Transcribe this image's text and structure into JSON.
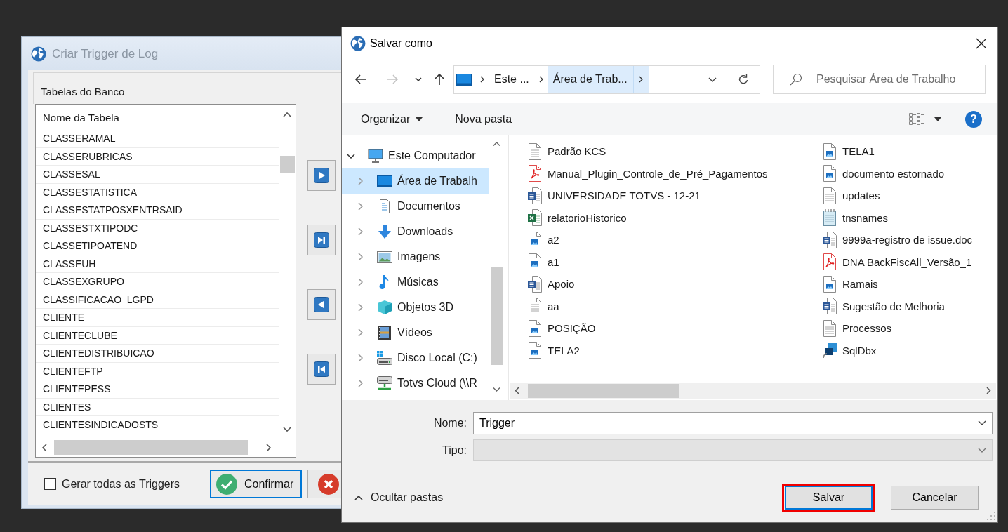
{
  "log_dialog": {
    "title": "Criar Trigger de Log",
    "active": false,
    "group_title": "Tabelas do Banco",
    "table_list": {
      "column": "Nome da Tabela",
      "rows": [
        {
          "name": "CLASSERAMAL",
          "selected": false
        },
        {
          "name": "CLASSERUBRICAS",
          "selected": false
        },
        {
          "name": "CLASSESAL",
          "selected": false
        },
        {
          "name": "CLASSESTATISTICA",
          "selected": false
        },
        {
          "name": "CLASSESTATPOSXENTRSAID",
          "selected": false
        },
        {
          "name": "CLASSESTXTIPODC",
          "selected": false
        },
        {
          "name": "CLASSETIPOATEND",
          "selected": false
        },
        {
          "name": "CLASSEUH",
          "selected": false
        },
        {
          "name": "CLASSEXGRUPO",
          "selected": false
        },
        {
          "name": "CLASSIFICACAO_LGPD",
          "selected": false
        },
        {
          "name": "CLIENTE",
          "selected": false
        },
        {
          "name": "CLIENTECLUBE",
          "selected": false
        },
        {
          "name": "CLIENTEDISTRIBUICAO",
          "selected": false
        },
        {
          "name": "CLIENTEFTP",
          "selected": false
        },
        {
          "name": "CLIENTEPESS",
          "selected": false
        },
        {
          "name": "CLIENTES",
          "selected": false
        },
        {
          "name": "CLIENTESINDICADOSTS",
          "selected": false
        }
      ]
    },
    "generate_all": {
      "label": "Gerar todas as Triggers",
      "checked": false
    },
    "confirm_button": {
      "label": "Confirmar",
      "focused": true
    }
  },
  "save_dialog": {
    "title": "Salvar como",
    "active": true,
    "nav_buttons": [
      {
        "kind": "back",
        "disabled": false
      },
      {
        "kind": "forward",
        "disabled": true
      },
      {
        "kind": "recent",
        "disabled": false
      },
      {
        "kind": "up",
        "disabled": false
      }
    ],
    "address_bar": {
      "segments": [
        {
          "label": "Este ...",
          "selected": false
        },
        {
          "label": "Área de Trab...",
          "selected": true
        }
      ]
    },
    "search": {
      "placeholder": "Pesquisar Área de Trabalho"
    },
    "toolbar": {
      "organize": "Organizar",
      "new_folder": "Nova pasta",
      "help": "?"
    },
    "nav_tree": [
      {
        "label": "Este Computador",
        "kind": "computer",
        "expanded": true,
        "selected": false,
        "children": [
          {
            "label": "Área de Trabalh",
            "kind": "desktop",
            "expanded": false,
            "selected": true
          },
          {
            "label": "Documentos",
            "kind": "documents",
            "expanded": false,
            "selected": false
          },
          {
            "label": "Downloads",
            "kind": "downloads",
            "expanded": false,
            "selected": false
          },
          {
            "label": "Imagens",
            "kind": "pictures",
            "expanded": false,
            "selected": false
          },
          {
            "label": "Músicas",
            "kind": "music",
            "expanded": false,
            "selected": false
          },
          {
            "label": "Objetos 3D",
            "kind": "objects3d",
            "expanded": false,
            "selected": false
          },
          {
            "label": "Vídeos",
            "kind": "videos",
            "expanded": false,
            "selected": false
          },
          {
            "label": "Disco Local (C:)",
            "kind": "drive",
            "expanded": false,
            "selected": false
          },
          {
            "label": "Totvs Cloud (\\\\R",
            "kind": "netdrive",
            "expanded": false,
            "selected": false
          }
        ]
      }
    ],
    "files": [
      {
        "name": "Padrão KCS",
        "kind": "text",
        "selected": false
      },
      {
        "name": "Manual_Plugin_Controle_de_Pré_Pagamentos",
        "kind": "pdf",
        "selected": false
      },
      {
        "name": "UNIVERSIDADE TOTVS - 12-21",
        "kind": "word",
        "selected": false
      },
      {
        "name": "relatorioHistorico",
        "kind": "excel",
        "selected": false
      },
      {
        "name": "a2",
        "kind": "image",
        "selected": false
      },
      {
        "name": "a1",
        "kind": "image",
        "selected": false
      },
      {
        "name": "Apoio",
        "kind": "word",
        "selected": false
      },
      {
        "name": "aa",
        "kind": "text",
        "selected": false
      },
      {
        "name": "POSIÇÃO",
        "kind": "image",
        "selected": false
      },
      {
        "name": "TELA2",
        "kind": "image",
        "selected": false
      },
      {
        "name": "TELA1",
        "kind": "image",
        "selected": false
      },
      {
        "name": "documento estornado",
        "kind": "image",
        "selected": false
      },
      {
        "name": "updates",
        "kind": "text",
        "selected": false
      },
      {
        "name": "tnsnames",
        "kind": "notepad",
        "selected": false
      },
      {
        "name": "9999a-registro de issue.doc",
        "kind": "word",
        "selected": false
      },
      {
        "name": "DNA BackFiscAll_Versão_1",
        "kind": "pdf",
        "selected": false
      },
      {
        "name": "Ramais",
        "kind": "image",
        "selected": false
      },
      {
        "name": "Sugestão de Melhoria",
        "kind": "word",
        "selected": false
      },
      {
        "name": "Processos",
        "kind": "text",
        "selected": false
      },
      {
        "name": "SqlDbx",
        "kind": "app",
        "selected": false
      }
    ],
    "file_name": {
      "label": "Nome:",
      "value": "Trigger"
    },
    "file_type": {
      "label": "Tipo:",
      "disabled": true
    },
    "hide_folders": "Ocultar pastas",
    "buttons": [
      {
        "label": "Salvar",
        "default": true,
        "highlighted": true
      },
      {
        "label": "Cancelar",
        "default": false,
        "highlighted": false
      }
    ]
  }
}
